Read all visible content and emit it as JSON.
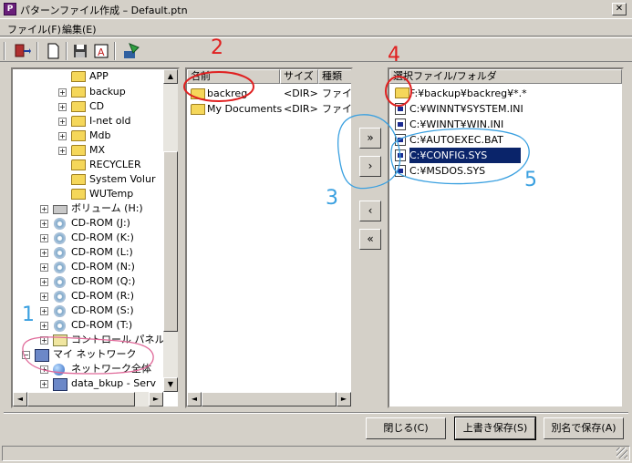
{
  "window": {
    "title": "パターンファイル作成 – Default.ptn",
    "close_glyph": "✕",
    "app_icon_letter": "P"
  },
  "menu": {
    "items": [
      {
        "label": "ファイル(F)"
      },
      {
        "label": "編集(E)"
      }
    ]
  },
  "toolbar": {
    "buttons": [
      "exit-icon",
      "new-file-icon",
      "save-icon",
      "save-as-icon",
      "run-icon"
    ]
  },
  "tree": {
    "items": [
      {
        "label": "APP",
        "icon": "folder-icon"
      },
      {
        "label": "backup",
        "icon": "folder-open-icon"
      },
      {
        "label": "CD",
        "icon": "folder-icon"
      },
      {
        "label": "I-net old",
        "icon": "folder-icon"
      },
      {
        "label": "Mdb",
        "icon": "folder-icon"
      },
      {
        "label": "MX",
        "icon": "folder-icon"
      },
      {
        "label": "RECYCLER",
        "icon": "folder-icon"
      },
      {
        "label": "System Volur",
        "icon": "folder-icon"
      },
      {
        "label": "WUTemp",
        "icon": "folder-icon"
      },
      {
        "label": "ボリューム (H:)",
        "icon": "drive-icon"
      },
      {
        "label": "CD-ROM (J:)",
        "icon": "cdrom-icon"
      },
      {
        "label": "CD-ROM (K:)",
        "icon": "cdrom-icon"
      },
      {
        "label": "CD-ROM (L:)",
        "icon": "cdrom-icon"
      },
      {
        "label": "CD-ROM (N:)",
        "icon": "cdrom-icon"
      },
      {
        "label": "CD-ROM (Q:)",
        "icon": "cdrom-icon"
      },
      {
        "label": "CD-ROM (R:)",
        "icon": "cdrom-icon"
      },
      {
        "label": "CD-ROM (S:)",
        "icon": "cdrom-icon"
      },
      {
        "label": "CD-ROM (T:)",
        "icon": "cdrom-icon"
      },
      {
        "label": "コントロール パネル",
        "icon": "control-panel-icon"
      },
      {
        "label": "マイ ネットワーク",
        "icon": "network-icon"
      },
      {
        "label": "ネットワーク全体",
        "icon": "globe-icon"
      },
      {
        "label": "data_bkup - Serv",
        "icon": "network-share-icon"
      }
    ]
  },
  "file_list": {
    "columns": [
      "名前",
      "サイズ",
      "種類"
    ],
    "rows": [
      {
        "name": "backreg",
        "size": "<DIR>",
        "type": "ファイル"
      },
      {
        "name": "My Documents",
        "size": "<DIR>",
        "type": "ファイル"
      }
    ]
  },
  "transfer": {
    "add_all": "»",
    "add": "›",
    "remove": "‹",
    "remove_all": "«"
  },
  "selected": {
    "header": "選択ファイル/フォルダ",
    "items": [
      "F:¥backup¥backreg¥*.*",
      "C:¥WINNT¥SYSTEM.INI",
      "C:¥WINNT¥WIN.INI",
      "C:¥AUTOEXEC.BAT",
      "C:¥CONFIG.SYS",
      "C:¥MSDOS.SYS"
    ],
    "selected_index": 4
  },
  "buttons": {
    "close": "閉じる(C)",
    "overwrite": "上書き保存(S)",
    "save_as": "別名で保存(A)"
  },
  "annotations": {
    "n1": "1",
    "n2": "2",
    "n3": "3",
    "n4": "4",
    "n5": "5",
    "red": "#e02020",
    "blue": "#3aa0e0"
  },
  "scroll_glyphs": {
    "up": "▲",
    "down": "▼",
    "left": "◄",
    "right": "►"
  }
}
